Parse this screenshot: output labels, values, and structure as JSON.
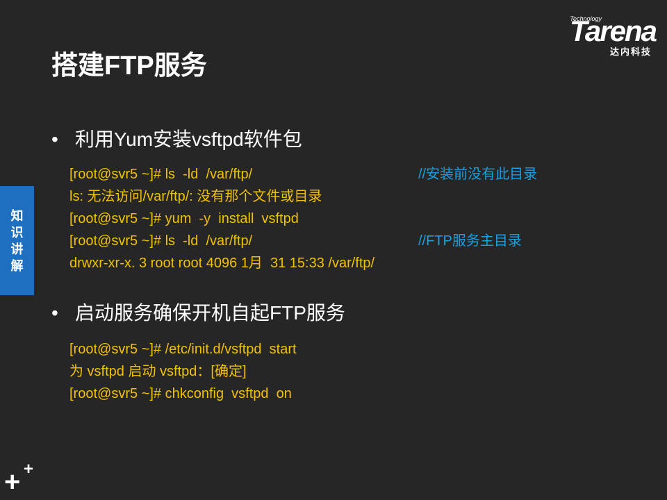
{
  "logo": {
    "technology": "Technology",
    "brand": "Tarena",
    "cn": "达内科技"
  },
  "title": "搭建FTP服务",
  "side_tab": [
    "知",
    "识",
    "讲",
    "解"
  ],
  "bullets": [
    {
      "dot": "•",
      "text": "利用Yum安装vsftpd软件包",
      "lines": [
        {
          "text": "[root@svr5 ~]# ls  -ld  /var/ftp/",
          "comment": "//安装前没有此目录"
        },
        {
          "text": "ls: 无法访问/var/ftp/: 没有那个文件或目录",
          "comment": ""
        },
        {
          "text": "[root@svr5 ~]# yum  -y  install  vsftpd",
          "comment": ""
        },
        {
          "text": "[root@svr5 ~]# ls  -ld  /var/ftp/",
          "comment": "//FTP服务主目录"
        },
        {
          "text": "drwxr-xr-x. 3 root root 4096 1月  31 15:33 /var/ftp/",
          "comment": ""
        }
      ]
    },
    {
      "dot": "•",
      "text": "启动服务确保开机自起FTP服务",
      "lines": [
        {
          "text": "[root@svr5 ~]# /etc/init.d/vsftpd  start",
          "comment": ""
        },
        {
          "text": "为 vsftpd 启动 vsftpd：[确定]",
          "comment": ""
        },
        {
          "text": "[root@svr5 ~]# chkconfig  vsftpd  on",
          "comment": ""
        }
      ]
    }
  ],
  "plus": {
    "big": "+",
    "small": "+"
  },
  "colors": {
    "background": "#262626",
    "code": "#f2c200",
    "comment": "#1a9fe0",
    "side_tab": "#1f6fc1"
  }
}
